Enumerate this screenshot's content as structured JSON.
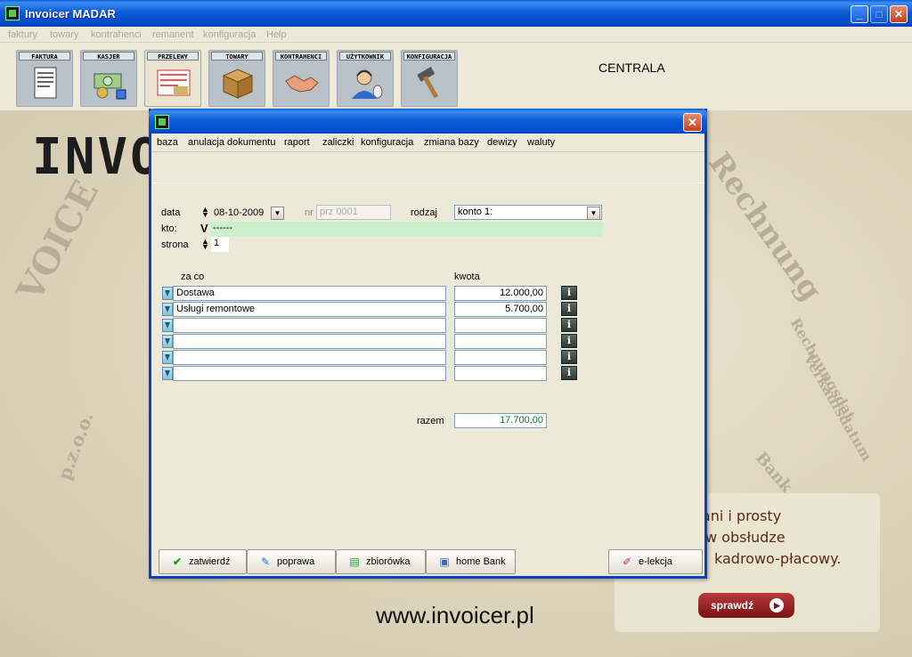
{
  "app": {
    "title": "Invoicer MADAR",
    "centrala": "CENTRALA"
  },
  "menubar": [
    "faktury",
    "towary",
    "kontrahenci",
    "remanent",
    "konfiguracja",
    "Help"
  ],
  "toolbar": [
    {
      "label": "FAKTURA",
      "icon": "invoice-document-icon"
    },
    {
      "label": "KASJER",
      "icon": "cash-money-icon"
    },
    {
      "label": "PRZELEWY",
      "icon": "bank-transfer-icon"
    },
    {
      "label": "TOWARY",
      "icon": "cardboard-box-icon"
    },
    {
      "label": "KONTRAHENCI",
      "icon": "handshake-icon"
    },
    {
      "label": "UŻYTKOWNIK",
      "icon": "user-headset-icon"
    },
    {
      "label": "KONFIGURACJA",
      "icon": "hammer-icon"
    }
  ],
  "background": {
    "headline": "INVO",
    "url": "www.invoicer.pl",
    "words": [
      "VOICE",
      "Rechnung",
      "Rechnungsdat",
      "Verkaufsdatum",
      "Bank",
      "p.z.o.o."
    ],
    "promo": [
      "y, tani i prosty",
      "w obsłudze",
      "kadrowo-płacowy."
    ],
    "promo_button": "sprawdź"
  },
  "dialog": {
    "menu": [
      "baza",
      "anulacja dokumentu",
      "raport",
      "zaliczki",
      "konfiguracja",
      "zmiana bazy",
      "dewizy",
      "waluty"
    ],
    "labels": {
      "data": "data",
      "nr": "nr",
      "rodzaj": "rodzaj",
      "kto": "kto:",
      "strona": "strona",
      "za_co": "za co",
      "kwota": "kwota",
      "razem": "razem"
    },
    "date": "08-10-2009",
    "nr_placeholder": "prz 0001",
    "rodzaj": "konto 1:",
    "kto_prefix": "V",
    "kto": "------",
    "strona": "1",
    "rows": [
      {
        "za_co": "Dostawa",
        "kwota": "12.000,00"
      },
      {
        "za_co": "Usługi remontowe",
        "kwota": "5.700,00"
      },
      {
        "za_co": "",
        "kwota": ""
      },
      {
        "za_co": "",
        "kwota": ""
      },
      {
        "za_co": "",
        "kwota": ""
      },
      {
        "za_co": "",
        "kwota": ""
      }
    ],
    "razem": "17.700,00",
    "buttons": {
      "zatwierdz": "zatwierdź",
      "poprawa": "poprawa",
      "zbiorowka": "zbiorówka",
      "home_bank": "home Bank",
      "elekcja": "e-lekcja"
    }
  }
}
